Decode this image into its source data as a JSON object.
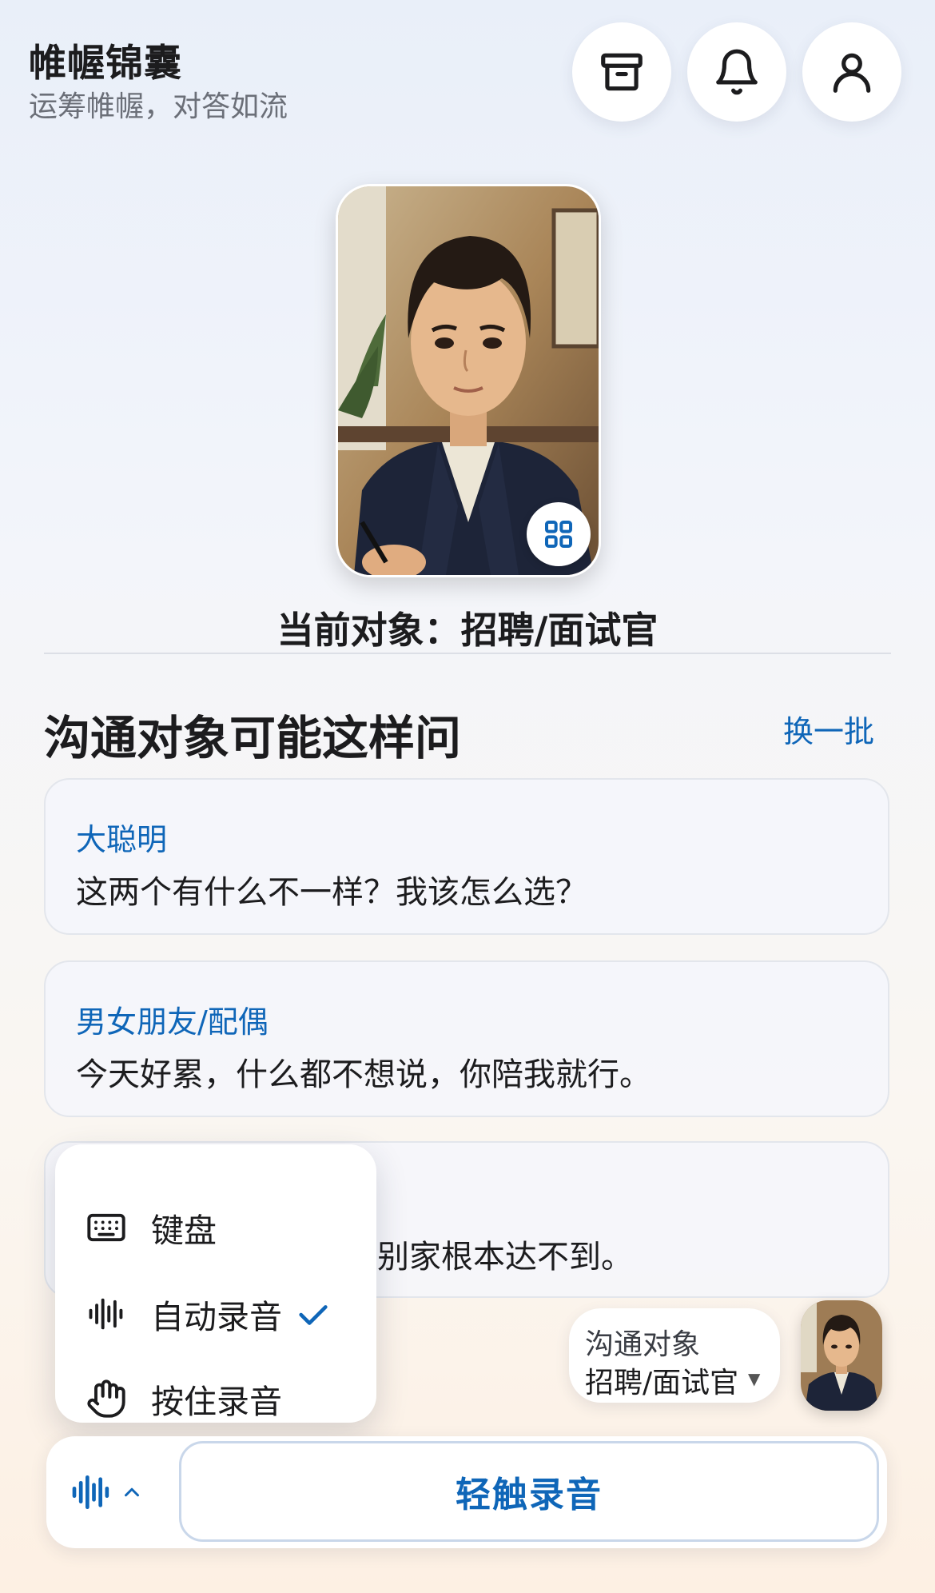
{
  "header": {
    "title": "帷幄锦囊",
    "subtitle": "运筹帷幄，对答如流"
  },
  "icons": {
    "archive": "archive-box-icon",
    "bell": "bell-icon",
    "user": "user-icon",
    "grid": "grid-icon"
  },
  "current_target": {
    "label": "当前对象：招聘/面试官"
  },
  "suggestions": {
    "title": "沟通对象可能这样问",
    "refresh_label": "换一批",
    "items": [
      {
        "role": "大聪明",
        "text": "这两个有什么不一样？我该怎么选？"
      },
      {
        "role": "男女朋友/配偶",
        "text": "今天好累，什么都不想说，你陪我就行。"
      },
      {
        "role": "",
        "text": "别家根本达不到。"
      }
    ]
  },
  "input_menu": {
    "items": [
      {
        "label": "键盘",
        "icon": "keyboard-icon",
        "selected": false
      },
      {
        "label": "自动录音",
        "icon": "waveform-icon",
        "selected": true
      },
      {
        "label": "按住录音",
        "icon": "hand-icon",
        "selected": false
      }
    ]
  },
  "target_selector": {
    "label": "沟通对象",
    "value": "招聘/面试官"
  },
  "bottom_bar": {
    "record_label": "轻触录音"
  },
  "colors": {
    "accent": "#0f66b8",
    "text": "#1c1c1e",
    "muted": "#6b6f78"
  }
}
